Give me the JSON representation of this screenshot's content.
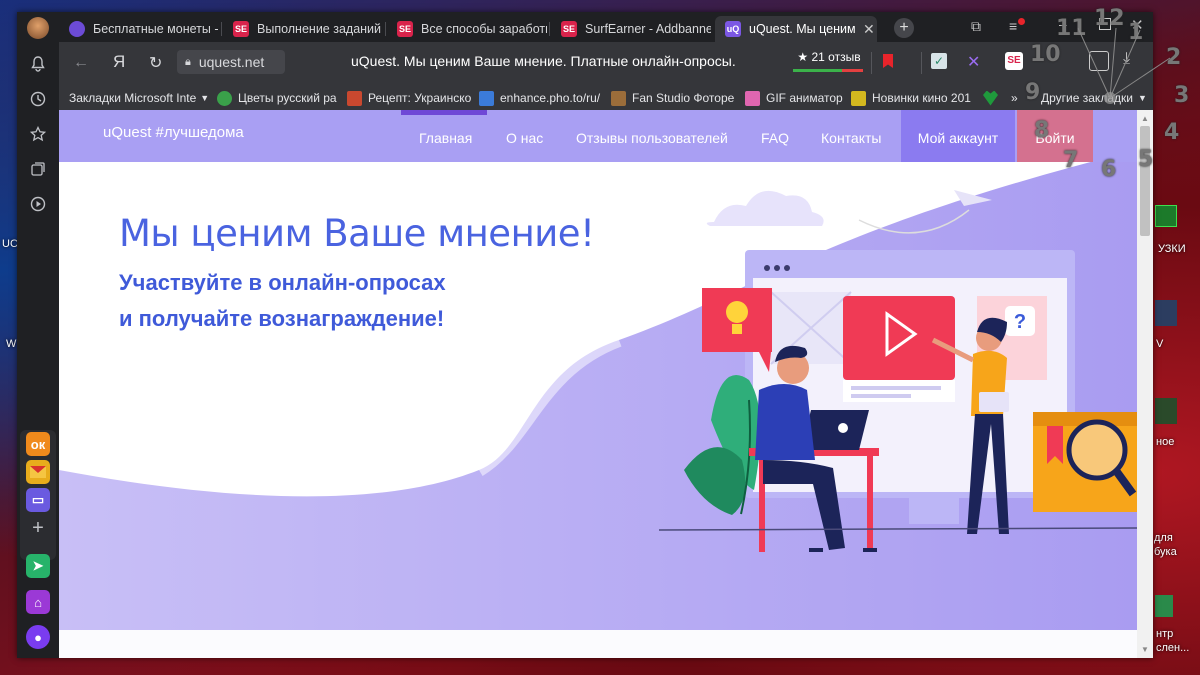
{
  "tabs": [
    {
      "label": "Бесплатные монеты - Sl",
      "fav_color": "#6c4bd6",
      "fav_text": ""
    },
    {
      "label": "Выполнение заданий",
      "fav_color": "#d9234b",
      "fav_text": "SE"
    },
    {
      "label": "Все способы заработка",
      "fav_color": "#d9234b",
      "fav_text": "SE"
    },
    {
      "label": "SurfEarner - Addbanner",
      "fav_color": "#d9234b",
      "fav_text": "SE"
    },
    {
      "label": "uQuest. Мы ценим Ва",
      "fav_color": "#7b57e4",
      "fav_text": "uQ",
      "active": true
    }
  ],
  "address": {
    "url": "uquest.net",
    "page_title": "uQuest. Мы ценим Ваше мнение. Платные онлайн-опросы.",
    "reviews": "★ 21 отзыв",
    "yandex_logo": "Я"
  },
  "bookmarks": [
    {
      "label": "Закладки Microsoft Inte",
      "fav_color": "#2a2b2e"
    },
    {
      "label": "Цветы русский ра",
      "fav_color": "#3aa14a"
    },
    {
      "label": "Рецепт: Украинско",
      "fav_color": "#c9482f"
    },
    {
      "label": "enhance.pho.to/ru/",
      "fav_color": "#3b7bd9"
    },
    {
      "label": "Fan Studio Фоторе",
      "fav_color": "#9b6d3a"
    },
    {
      "label": "GIF аниматор",
      "fav_color": "#e066b0"
    },
    {
      "label": "Новинки кино 201",
      "fav_color": "#d3b81f"
    }
  ],
  "bookmarks_more": "Другие закладки",
  "site": {
    "logo": "uQuest #лучшедома",
    "nav": [
      "Главная",
      "О нас",
      "Отзывы пользователей",
      "FAQ",
      "Контакты"
    ],
    "account": "Мой аккаунт",
    "login": "Войти",
    "hero_title": "Мы ценим Ваше мнение!",
    "hero_line1": "Участвуйте в онлайн-опросах",
    "hero_line2": "и получайте вознаграждение!"
  },
  "annotations": [
    "1",
    "2",
    "3",
    "4",
    "5",
    "6",
    "7",
    "8",
    "9",
    "10",
    "11",
    "12"
  ],
  "desktop_icons": [
    "UC",
    "W",
    "УЗКИ",
    "V",
    "ное",
    "для",
    "бука",
    "нтр",
    "слен..."
  ],
  "colors": {
    "nav_bg": "#a99ff3",
    "login_bg": "#d4718f",
    "account_bg": "#8b7bf0",
    "hero_text": "#4a63e0"
  }
}
